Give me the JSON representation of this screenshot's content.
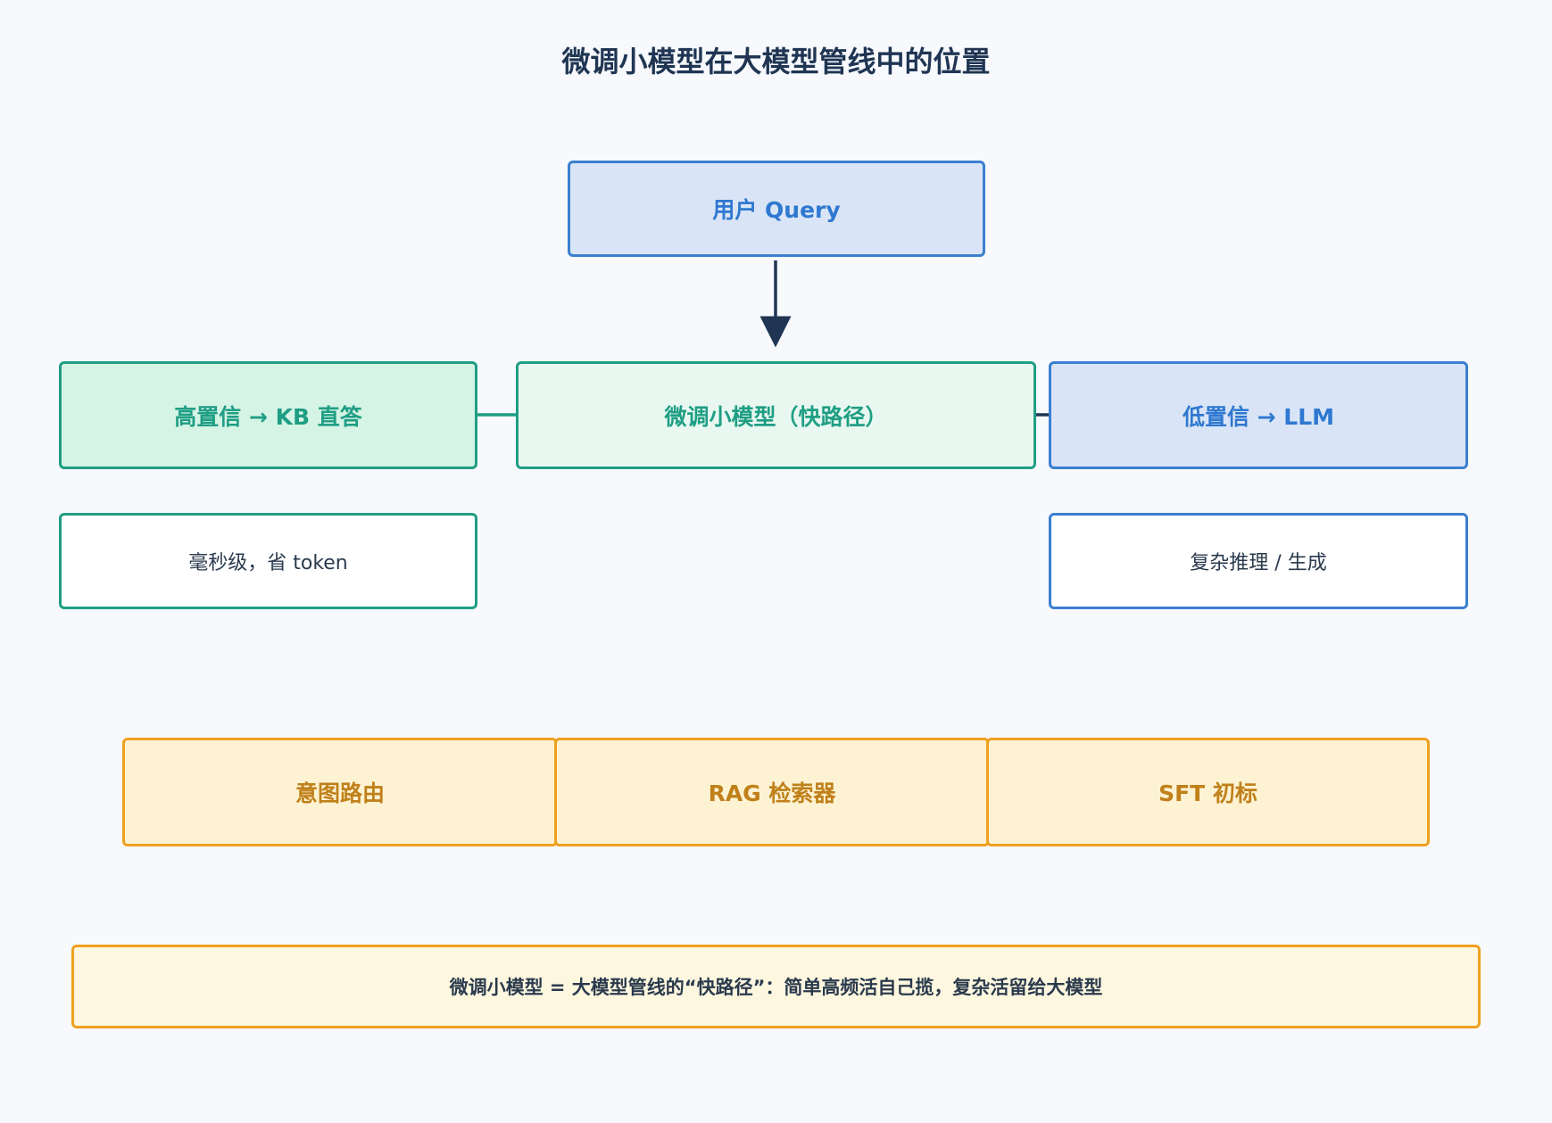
{
  "title": "微调小模型在大模型管线中的位置",
  "nodes": {
    "query": "用户 Query",
    "small_model": "微调小模型（快路径）",
    "high_conf": "高置信 → KB 直答",
    "low_conf": "低置信 → LLM",
    "high_detail": "毫秒级，省 token",
    "low_detail": "复杂推理 / 生成"
  },
  "use_cases": [
    {
      "label": "意图路由"
    },
    {
      "label": "RAG 检索器"
    },
    {
      "label": "SFT 初标"
    }
  ],
  "summary": "微调小模型 = 大模型管线的“快路径”：简单高频活自己揽，复杂活留给大模型",
  "colors": {
    "blue": "#3a7fd0",
    "green": "#1f9e84",
    "orange": "#f0a020",
    "dark": "#1f3553"
  }
}
